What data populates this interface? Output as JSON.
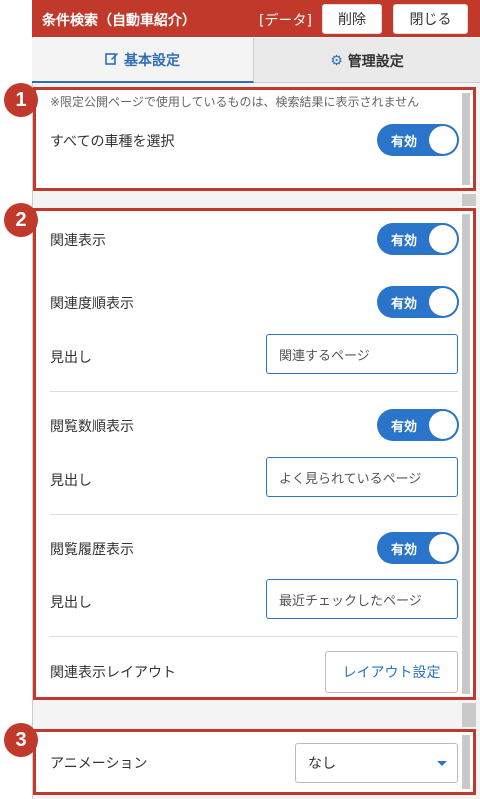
{
  "header": {
    "title": "条件検索（自動車紹介）",
    "data_label": "[データ]",
    "delete_label": "削除",
    "close_label": "閉じる"
  },
  "tabs": [
    {
      "label": "基本設定",
      "icon": "edit-icon"
    },
    {
      "label": "管理設定",
      "icon": "gear-icon"
    }
  ],
  "badges": [
    "1",
    "2",
    "3"
  ],
  "section1": {
    "note": "※限定公開ページで使用しているものは、検索結果に表示されません",
    "all_vehicles_label": "すべての車種を選択",
    "all_vehicles_toggle": "有効"
  },
  "section2": {
    "related_display_label": "関連表示",
    "related_display_toggle": "有効",
    "relevance_order_label": "関連度順表示",
    "relevance_order_toggle": "有効",
    "heading1_label": "見出し",
    "heading1_value": "関連するページ",
    "views_order_label": "閲覧数順表示",
    "views_order_toggle": "有効",
    "heading2_label": "見出し",
    "heading2_value": "よく見られているページ",
    "history_label": "閲覧履歴表示",
    "history_toggle": "有効",
    "heading3_label": "見出し",
    "heading3_value": "最近チェックしたページ",
    "layout_label": "関連表示レイアウト",
    "layout_button": "レイアウト設定"
  },
  "section3": {
    "animation_label": "アニメーション",
    "animation_value": "なし"
  },
  "colors": {
    "accent": "#c0392b",
    "primary": "#2a74c9"
  }
}
